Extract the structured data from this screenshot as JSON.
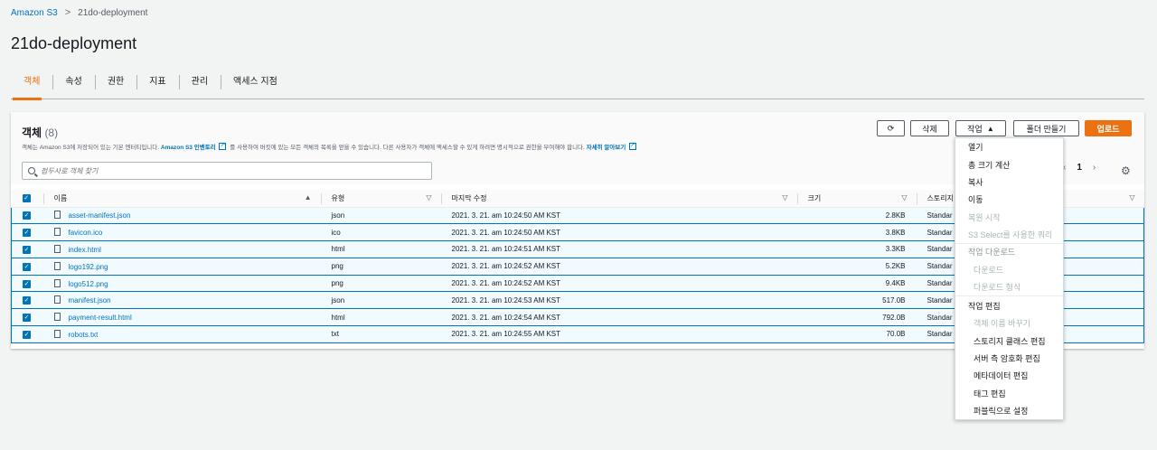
{
  "breadcrumb": {
    "root": "Amazon S3",
    "separator": ">",
    "current": "21do-deployment"
  },
  "page_title": "21do-deployment",
  "tabs": [
    "객체",
    "속성",
    "권한",
    "지표",
    "관리",
    "액세스 지점"
  ],
  "active_tab": "객체",
  "objects_panel": {
    "title": "객체",
    "count": "(8)",
    "desc_pre": "객체는 Amazon S3에 저장되어 있는 기본 엔터티입니다.",
    "desc_link1": "Amazon S3 인벤토리",
    "desc_mid": "를 사용하여 버킷에 있는 모든 객체의 목록을 얻을 수 있습니다. 다른 사용자가 객체에 액세스할 수 있게 하려면 명시적으로 권한을 부여해야 합니다.",
    "desc_link2": "자세히 알아보기",
    "search_placeholder": "접두사로 객체 찾기",
    "buttons": {
      "delete": "삭제",
      "actions": "작업",
      "create_folder": "폴더 만들기",
      "upload": "업로드"
    },
    "page_number": "1",
    "pager_prev": "‹",
    "pager_next": "›"
  },
  "table": {
    "columns": [
      "이름",
      "유형",
      "마지막 수정",
      "크기",
      "스토리지"
    ],
    "rows": [
      {
        "name": "asset-manifest.json",
        "type": "json",
        "modified": "2021. 3. 21. am 10:24:50 AM KST",
        "size": "2.8KB",
        "storage": "Standar"
      },
      {
        "name": "favicon.ico",
        "type": "ico",
        "modified": "2021. 3. 21. am 10:24:50 AM KST",
        "size": "3.8KB",
        "storage": "Standar"
      },
      {
        "name": "index.html",
        "type": "html",
        "modified": "2021. 3. 21. am 10:24:51 AM KST",
        "size": "3.3KB",
        "storage": "Standar"
      },
      {
        "name": "logo192.png",
        "type": "png",
        "modified": "2021. 3. 21. am 10:24:52 AM KST",
        "size": "5.2KB",
        "storage": "Standar"
      },
      {
        "name": "logo512.png",
        "type": "png",
        "modified": "2021. 3. 21. am 10:24:52 AM KST",
        "size": "9.4KB",
        "storage": "Standar"
      },
      {
        "name": "manifest.json",
        "type": "json",
        "modified": "2021. 3. 21. am 10:24:53 AM KST",
        "size": "517.0B",
        "storage": "Standar"
      },
      {
        "name": "payment-result.html",
        "type": "html",
        "modified": "2021. 3. 21. am 10:24:54 AM KST",
        "size": "792.0B",
        "storage": "Standar"
      },
      {
        "name": "robots.txt",
        "type": "txt",
        "modified": "2021. 3. 21. am 10:24:55 AM KST",
        "size": "70.0B",
        "storage": "Standar"
      }
    ]
  },
  "actions_menu": {
    "open": "열기",
    "calc_size": "총 크기 계산",
    "copy": "복사",
    "move": "이동",
    "restore": "복원 시작",
    "s3_select": "S3 Select를 사용한 쿼리",
    "download_group": "작업 다운로드",
    "download": "다운로드",
    "download_as": "다운로드 형식",
    "edit_group": "작업 편집",
    "rename": "객체 이름 바꾸기",
    "storage_class": "스토리지 클래스 편집",
    "encryption": "서버 측 암호화 편집",
    "metadata": "메타데이터 편집",
    "tags": "태그 편집",
    "make_public": "퍼블릭으로 설정"
  },
  "colors": {
    "accent": "#ec7211",
    "link": "#0073bb",
    "selected_row": "#f1faff"
  }
}
